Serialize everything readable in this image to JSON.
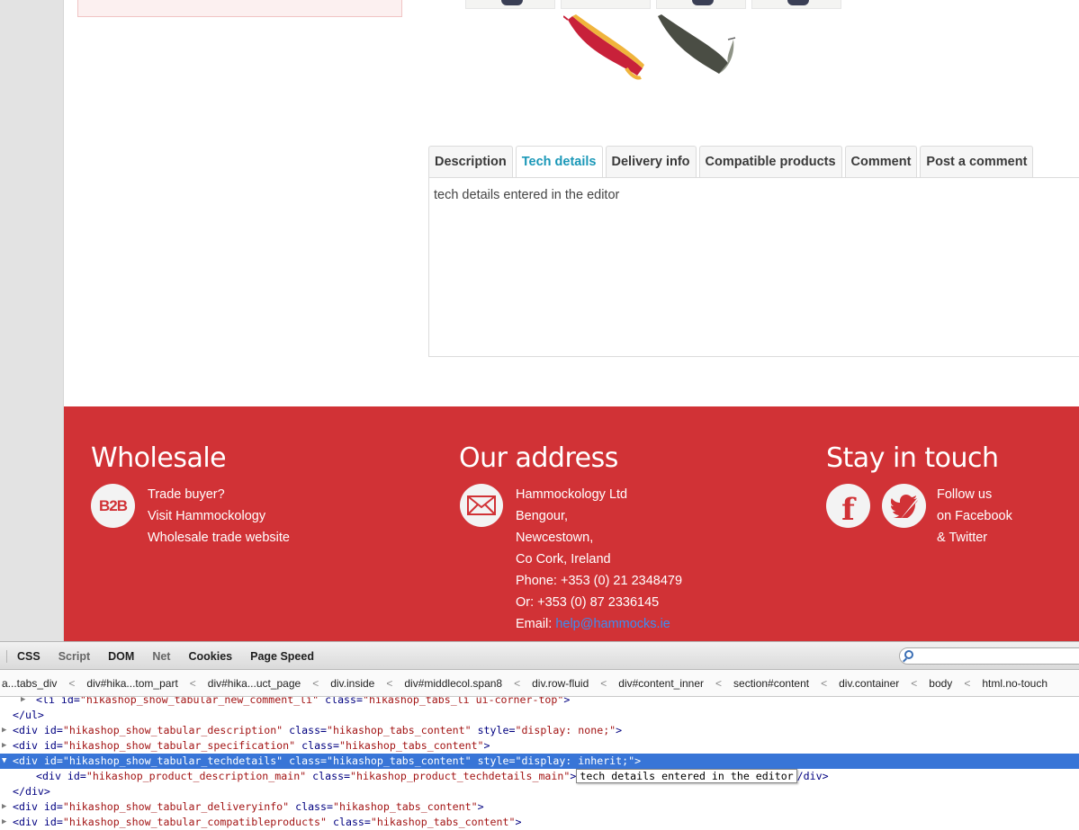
{
  "product": {
    "tabs": [
      {
        "label": "Description",
        "active": false
      },
      {
        "label": "Tech details",
        "active": true
      },
      {
        "label": "Delivery info",
        "active": false
      },
      {
        "label": "Compatible products",
        "active": false
      },
      {
        "label": "Comment",
        "active": false
      },
      {
        "label": "Post a comment",
        "active": false
      }
    ],
    "panel_text": "tech details entered in the editor",
    "hammock_colors": [
      "#c8213a",
      "#f0b43c",
      "#4a4d44",
      "#8f9487"
    ]
  },
  "footer": {
    "wholesale": {
      "title": "Wholesale",
      "badge": "B2B",
      "lines": [
        "Trade buyer?",
        "Visit Hammockology",
        "Wholesale trade website"
      ]
    },
    "address": {
      "title": "Our address",
      "icon": "envelope-icon",
      "lines": [
        "Hammockology Ltd",
        "Bengour,",
        "Newcestown,",
        "Co Cork, Ireland",
        "Phone: +353 (0) 21 2348479",
        "Or: +353 (0) 87 2336145"
      ],
      "email_label": "Email: ",
      "email": "help@hammocks.ie"
    },
    "social": {
      "title": "Stay in touch",
      "icons": [
        "facebook-icon",
        "twitter-icon"
      ],
      "lines": [
        "Follow us",
        "on Facebook",
        "& Twitter"
      ]
    },
    "bg_color": "#d13236"
  },
  "devtools": {
    "tabs": [
      "CSS",
      "Script",
      "DOM",
      "Net",
      "Cookies",
      "Page Speed"
    ],
    "crumbs": [
      "a...tabs_div",
      "div#hika...tom_part",
      "div#hika...uct_page",
      "div.inside",
      "div#middlecol.span8",
      "div.row-fluid",
      "div#content_inner",
      "section#content",
      "div.container",
      "body",
      "html.no-touch"
    ],
    "html_lines": {
      "l0": {
        "tag_open": "<li ",
        "a1": "id=",
        "v1": "\"hikashop_show_tabular_new_comment_li\"",
        "a2": " class=",
        "v2": "\"hikashop_tabs_li ui-corner-top\"",
        "tag_close": ">"
      },
      "l1": "</ul>",
      "l2": {
        "tag_open": "<div ",
        "a1": "id=",
        "v1": "\"hikashop_show_tabular_description\"",
        "a2": " class=",
        "v2": "\"hikashop_tabs_content\"",
        "a3": " style=",
        "v3": "\"display: none;\"",
        "tag_close": ">"
      },
      "l3": {
        "tag_open": "<div ",
        "a1": "id=",
        "v1": "\"hikashop_show_tabular_specification\"",
        "a2": " class=",
        "v2": "\"hikashop_tabs_content\"",
        "tag_close": ">"
      },
      "l4": {
        "tag_open": "<div ",
        "a1": "id=",
        "v1": "\"hikashop_show_tabular_techdetails\"",
        "a2": " class=",
        "v2": "\"hikashop_tabs_content\"",
        "a3": " style=",
        "v3": "\"display: inherit;\"",
        "tag_close": ">"
      },
      "l5": {
        "tag_open": "<div ",
        "a1": "id=",
        "v1": "\"hikashop_product_description_main\"",
        "a2": " class=",
        "v2": "\"hikashop_product_techdetails_main\"",
        "tag_close": ">",
        "tooltip": "tech details entered in the editor",
        "tail": "/div>"
      },
      "l6": "</div>",
      "l7": {
        "tag_open": "<div ",
        "a1": "id=",
        "v1": "\"hikashop_show_tabular_deliveryinfo\"",
        "a2": " class=",
        "v2": "\"hikashop_tabs_content\"",
        "tag_close": ">"
      },
      "l8": {
        "tag_open": "<div ",
        "a1": "id=",
        "v1": "\"hikashop_show_tabular_compatibleproducts\"",
        "a2": " class=",
        "v2": "\"hikashop_tabs_content\"",
        "tag_close": ">"
      }
    }
  }
}
